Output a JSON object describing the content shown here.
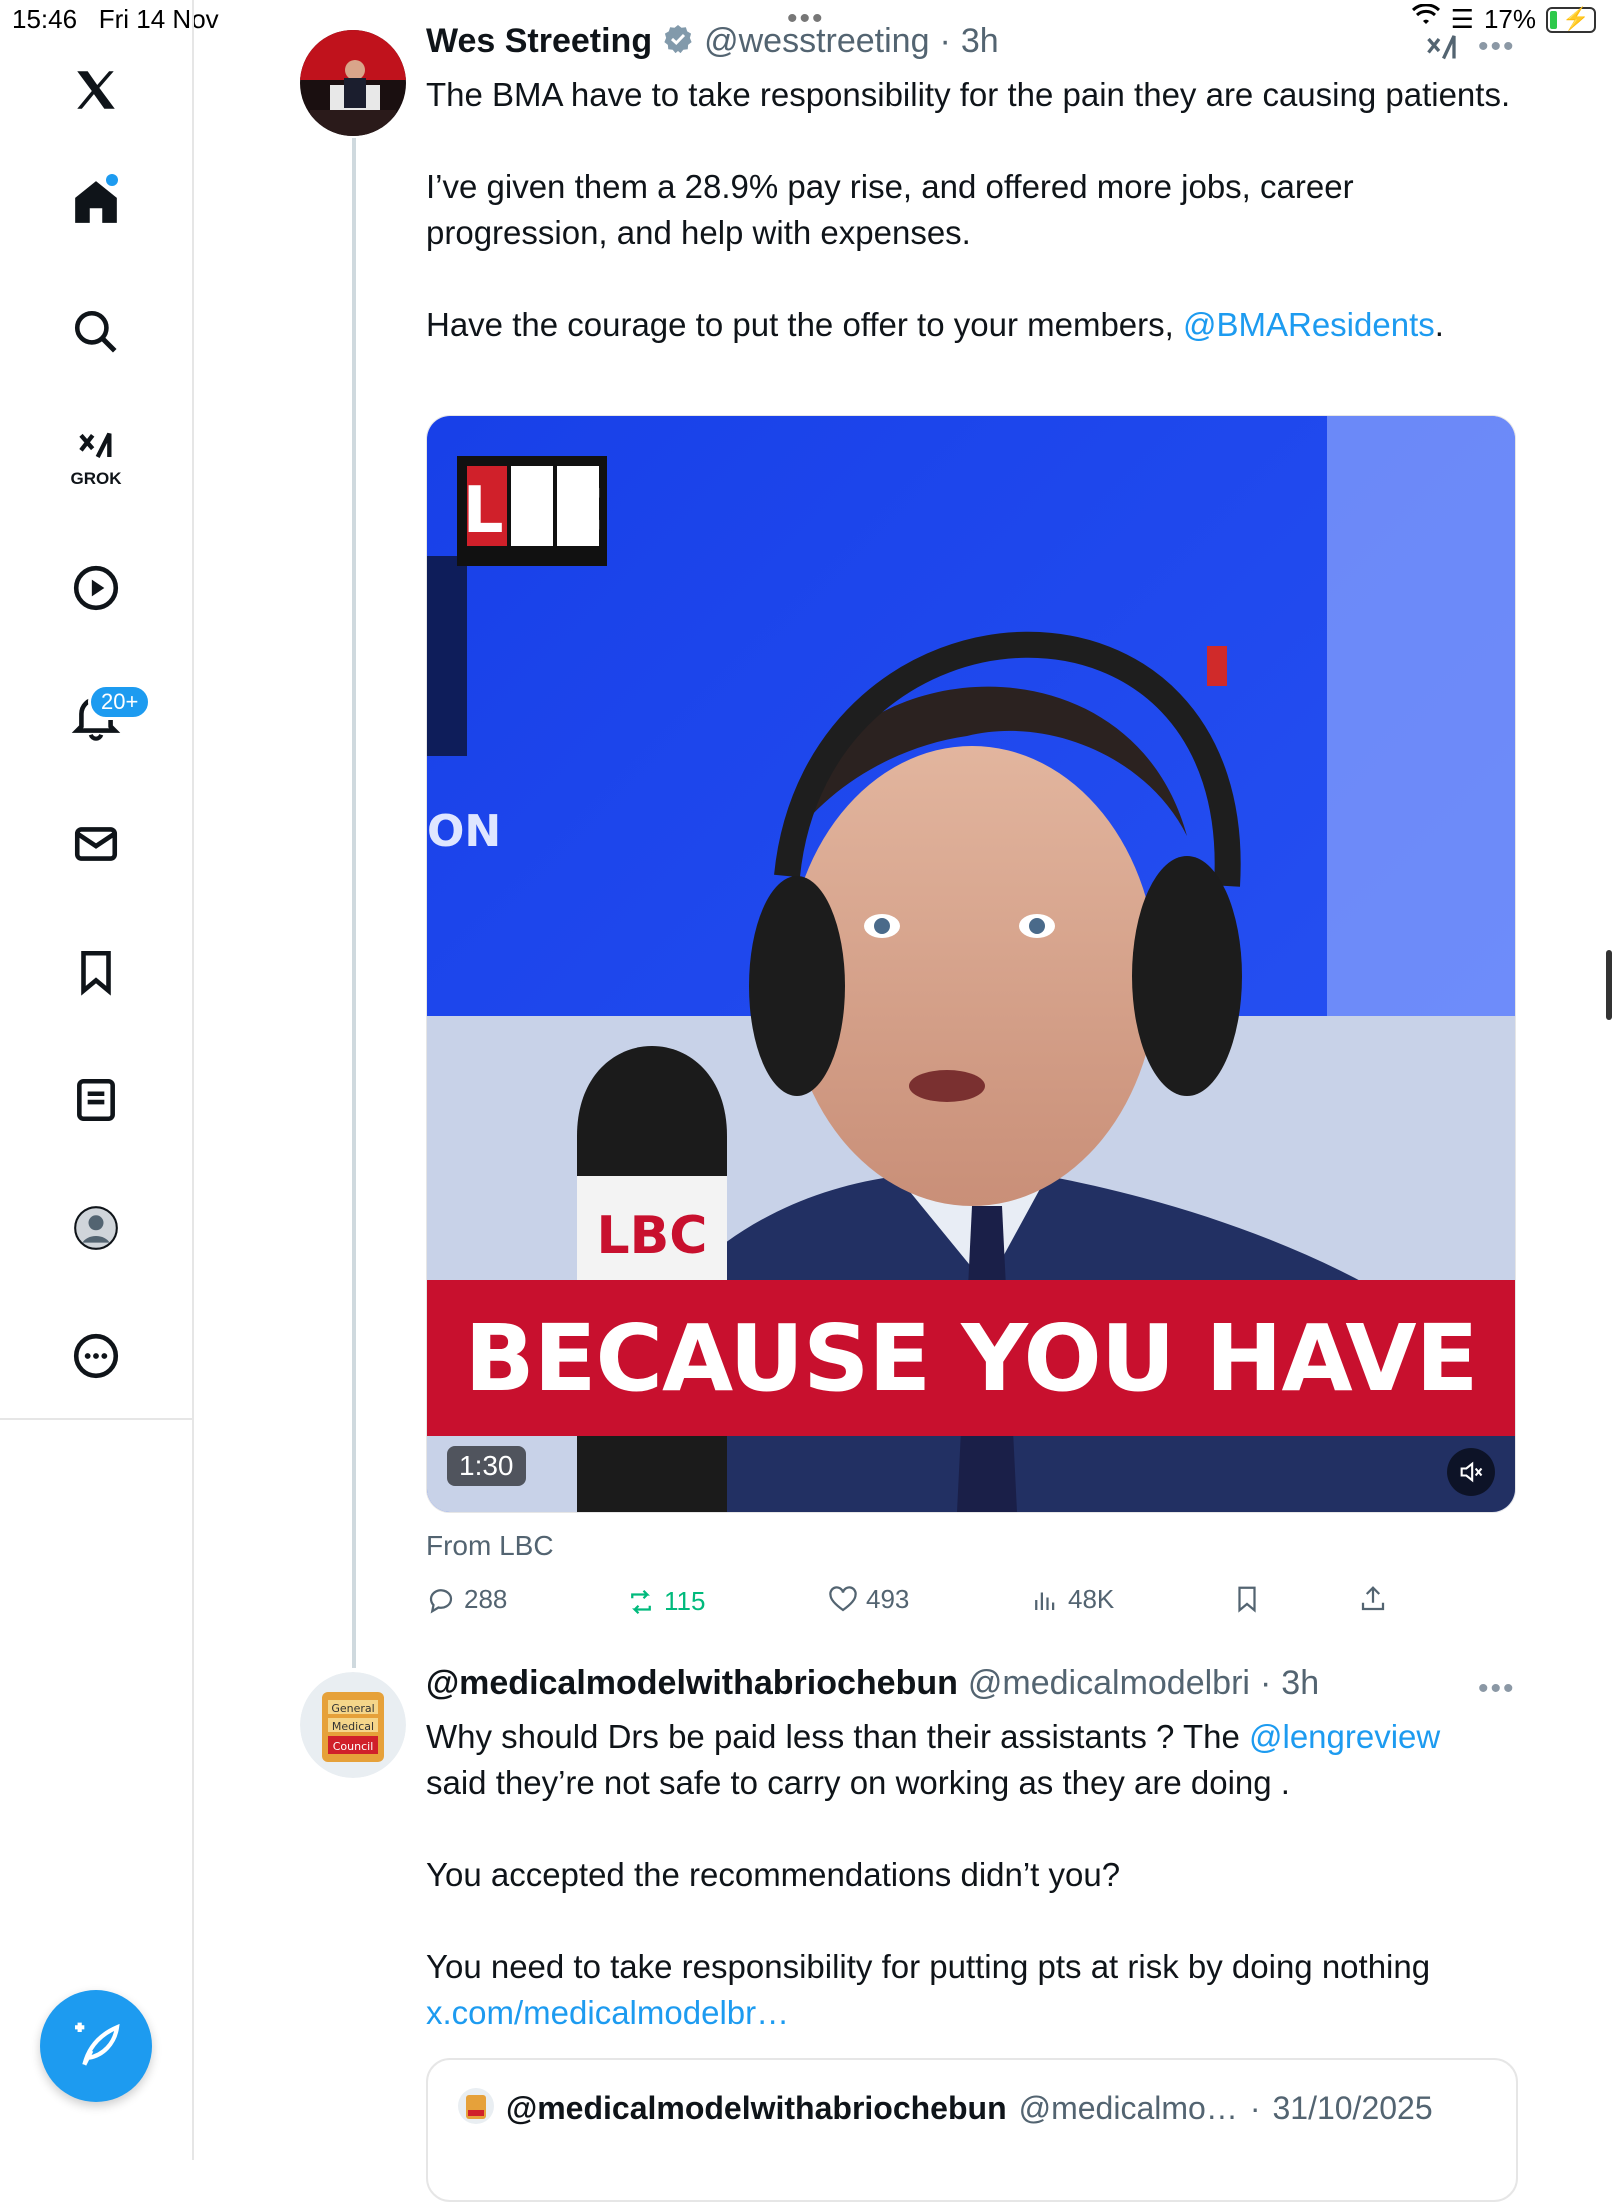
{
  "status_bar": {
    "time": "15:46",
    "date": "Fri 14 Nov",
    "battery": "17%"
  },
  "sidebar": {
    "items": [
      {
        "name": "x-logo-icon"
      },
      {
        "name": "home-icon"
      },
      {
        "name": "search-icon"
      },
      {
        "name": "grok-icon",
        "label": "GROK"
      },
      {
        "name": "video-icon"
      },
      {
        "name": "notifications-icon",
        "badge": "20+"
      },
      {
        "name": "messages-icon"
      },
      {
        "name": "bookmarks-icon"
      },
      {
        "name": "lists-icon"
      },
      {
        "name": "profile-icon"
      },
      {
        "name": "more-icon"
      }
    ]
  },
  "tweet": {
    "author_name": "Wes Streeting",
    "handle": "@wesstreeting",
    "time": "3h",
    "text_main": "The BMA have to take responsibility for the pain they are causing patients.\n\nI’ve given them a 28.9% pay rise, and offered more jobs, career progression, and help with expenses.\n\nHave the courage to put the offer to your members, ",
    "mention": "@BMAResidents",
    "text_end": ".",
    "video": {
      "brand": "LBC",
      "caption": "BECAUSE YOU HAVE",
      "duration": "1:30",
      "mic_brand": "LBC"
    },
    "source": "From LBC",
    "stats": {
      "replies": "288",
      "reposts": "115",
      "likes": "493",
      "views": "48K"
    }
  },
  "reply": {
    "author_name": "@medicalmodelwithabriochebun",
    "handle": "@medicalmodelbri",
    "time": "3h",
    "text_part1": "Why should Drs be paid less than their assistants ? The ",
    "mention": "@lengreview",
    "text_part2": "said they’re not safe to carry on working as they are doing .\n\nYou accepted the recommendations didn’t you?\n\nYou need to take responsibility for putting pts at risk by doing nothing",
    "link": "x.com/medicalmodelbr…",
    "quote": {
      "author_name": "@medicalmodelwithabriochebun",
      "handle": "@medicalmo…",
      "date": "31/10/2025"
    }
  },
  "colors": {
    "accent": "#1d9bf0",
    "repost": "#00ba7c",
    "lbc_red": "#c8102e",
    "studio_blue": "#1f3fe0"
  }
}
